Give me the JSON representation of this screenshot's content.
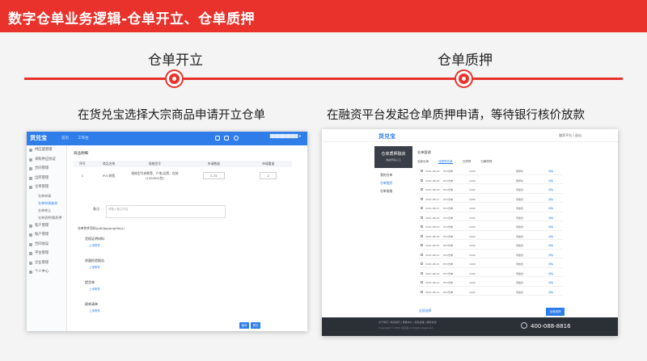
{
  "title": "数字仓单业务逻辑-仓单开立、仓单质押",
  "accent_color": "#e8322b",
  "steps": [
    {
      "label": "仓单开立",
      "description": "在货兑宝选择大宗商品申请开立仓单"
    },
    {
      "label": "仓单质押",
      "description": "在融资平台发起仓单质押申请，等待银行核价放款"
    }
  ],
  "shot1": {
    "logo": "货兑宝",
    "nav": [
      "首页",
      "工作台"
    ],
    "sidebar": [
      "供应链管理",
      "采购供应协议",
      "合同管理",
      "出库管理",
      "仓单管理",
      "客户管理",
      "账户管理",
      "合同协议",
      "平台管理",
      "企业管理",
      "个人中心"
    ],
    "sidebar_sub": [
      "仓单申请",
      "仓单申请查询",
      "仓单转让",
      "仓单质押/解质押"
    ],
    "section": "商品明细",
    "table_headers": [
      "序号",
      "商品名称",
      "规格型号",
      "申请数量",
      "申请重量"
    ],
    "row": [
      "1",
      "PVC树脂",
      "规格型号参数等，产地/品牌，包装(1000KG/包)",
      "2.72",
      "2"
    ],
    "remark_label": "备注:",
    "remark_placeholder": "请输入备注内容",
    "attach_label": "仓单附件资料(pdf/jpg/png/docx)",
    "docs": [
      "货权证明材料",
      "质量检验报告",
      "提货单",
      "磅单清单"
    ],
    "upload_label": "上传附件",
    "buttons": [
      "保存",
      "提交"
    ]
  },
  "shot2": {
    "logo": "货兑宝",
    "user": "融资平台 | 退出",
    "card_title": "仓单质押融资",
    "card_sub": "融资申请入口",
    "sidebar": [
      "我的仓单",
      "仓单融资",
      "仓单收储"
    ],
    "heading": "仓单管理",
    "tabs": [
      "全部仓单",
      "待质押仓单",
      "已质押",
      "已解质押"
    ],
    "rows": [
      [
        "2021-08-18",
        "PVC仓单",
        "1000",
        "质押中",
        "详情"
      ],
      [
        "2021-08-18",
        "PVC仓单",
        "1000",
        "质押中",
        "详情"
      ],
      [
        "2021-08-18",
        "PVC仓单",
        "1000",
        "待放款",
        "详情"
      ],
      [
        "2021-08-17",
        "PVC仓单",
        "1000",
        "待放款",
        "详情"
      ],
      [
        "2021-08-17",
        "PVC仓单",
        "1000",
        "待放款",
        "详情"
      ],
      [
        "2021-08-16",
        "PVC仓单",
        "1000",
        "待放款",
        "详情"
      ],
      [
        "2021-08-16",
        "PVC仓单",
        "1000",
        "待放款",
        "详情"
      ],
      [
        "2021-08-16",
        "PVC仓单",
        "1000",
        "待放款",
        "详情"
      ],
      [
        "2021-08-15",
        "PVC仓单",
        "1000",
        "待放款",
        "详情"
      ],
      [
        "2021-08-15",
        "PVC仓单",
        "1000",
        "待放款",
        "详情"
      ],
      [
        "2021-08-15",
        "PVC仓单",
        "1000",
        "待放款",
        "详情"
      ],
      [
        "2021-08-14",
        "PVC仓单",
        "1000",
        "待放款",
        "详情"
      ],
      [
        "2021-08-14",
        "PVC仓单",
        "1000",
        "待放款",
        "详情"
      ],
      [
        "2021-08-14",
        "PVC仓单",
        "1000",
        "待放款",
        "详情"
      ]
    ],
    "select_label": "全部选择",
    "submit": "仓单质押",
    "footer_links": "关于我们 | 联系我们 | 帮助中心 | 隐私政策 | 服务条款",
    "footer_copy": "Copyright © 2021 货兑宝 All Rights Reserved",
    "phone": "400-088-8816"
  }
}
